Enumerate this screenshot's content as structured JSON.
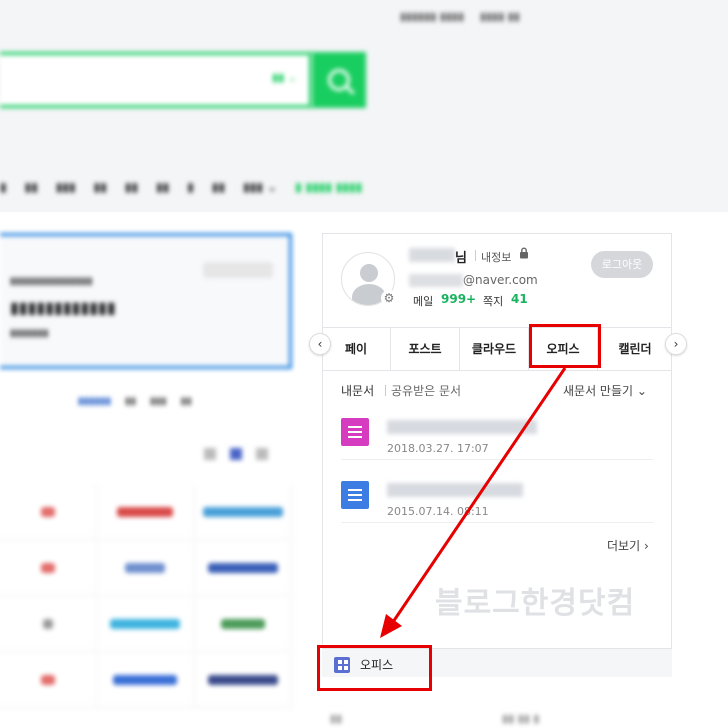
{
  "user": {
    "name_suffix": "님",
    "my_info": "내정보",
    "email_domain": "@naver.com",
    "mail_label": "메일",
    "mail_count": "999+",
    "note_label": "쪽지",
    "note_count": "41",
    "logout": "로그아웃"
  },
  "tabs": [
    "페이",
    "포스트",
    "클라우드",
    "오피스",
    "캘린더"
  ],
  "docs": {
    "filter_mine": "내문서",
    "filter_shared": "공유받은 문서",
    "new_doc": "새문서 만들기",
    "items": [
      {
        "date": "2018.03.27. 17:07",
        "icon": "list-doc-icon",
        "color": "#d63cc0"
      },
      {
        "date": "2015.07.14. 08:11",
        "icon": "text-doc-icon",
        "color": "#3b7de3"
      }
    ],
    "more": "더보기"
  },
  "office_row": {
    "label": "오피스"
  },
  "watermark": "블로그한경닷컴",
  "colors": {
    "naver_green": "#19ce60",
    "highlight_red": "#e60000",
    "count_green": "#19b35f"
  }
}
